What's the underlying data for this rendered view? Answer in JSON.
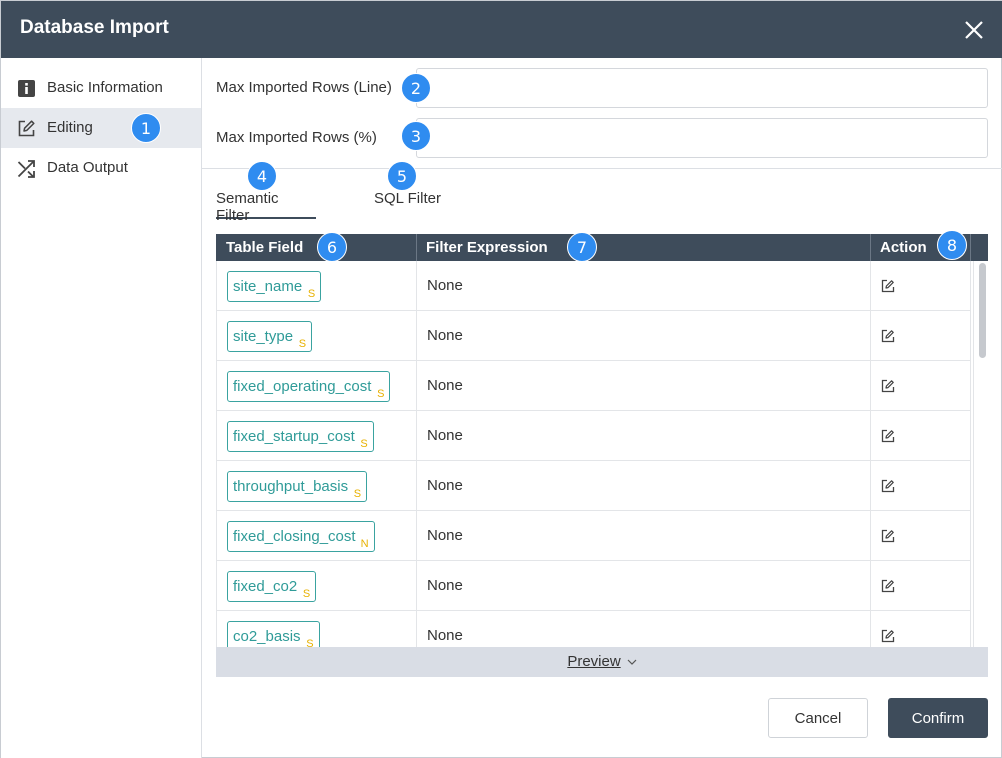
{
  "dialog": {
    "title": "Database Import"
  },
  "sidebar": {
    "items": [
      {
        "label": "Basic Information",
        "icon": "info-icon",
        "active": false
      },
      {
        "label": "Editing",
        "icon": "edit-icon",
        "active": true
      },
      {
        "label": "Data Output",
        "icon": "shuffle-icon",
        "active": false
      }
    ]
  },
  "fields": {
    "max_rows_line_label": "Max Imported Rows (Line)",
    "max_rows_line_value": "",
    "max_rows_pct_label": "Max Imported Rows (%)",
    "max_rows_pct_value": ""
  },
  "tabs": [
    {
      "label": "Semantic Filter",
      "active": true
    },
    {
      "label": "SQL Filter",
      "active": false
    }
  ],
  "table": {
    "headers": [
      "Table Field",
      "Filter Expression",
      "Action"
    ],
    "rows": [
      {
        "field": "site_name",
        "type": "S",
        "expression": "None"
      },
      {
        "field": "site_type",
        "type": "S",
        "expression": "None"
      },
      {
        "field": "fixed_operating_cost",
        "type": "S",
        "expression": "None"
      },
      {
        "field": "fixed_startup_cost",
        "type": "S",
        "expression": "None"
      },
      {
        "field": "throughput_basis",
        "type": "S",
        "expression": "None"
      },
      {
        "field": "fixed_closing_cost",
        "type": "N",
        "expression": "None"
      },
      {
        "field": "fixed_co2",
        "type": "S",
        "expression": "None"
      },
      {
        "field": "co2_basis",
        "type": "S",
        "expression": "None"
      }
    ]
  },
  "preview": {
    "label": "Preview"
  },
  "buttons": {
    "cancel": "Cancel",
    "confirm": "Confirm"
  },
  "callouts": [
    "1",
    "2",
    "3",
    "4",
    "5",
    "6",
    "7",
    "8"
  ],
  "colors": {
    "header_bg": "#3e4c5b",
    "callout_blue": "#2f8cf0",
    "chip_teal": "#2f9b98",
    "type_yellow": "#e8b100"
  }
}
